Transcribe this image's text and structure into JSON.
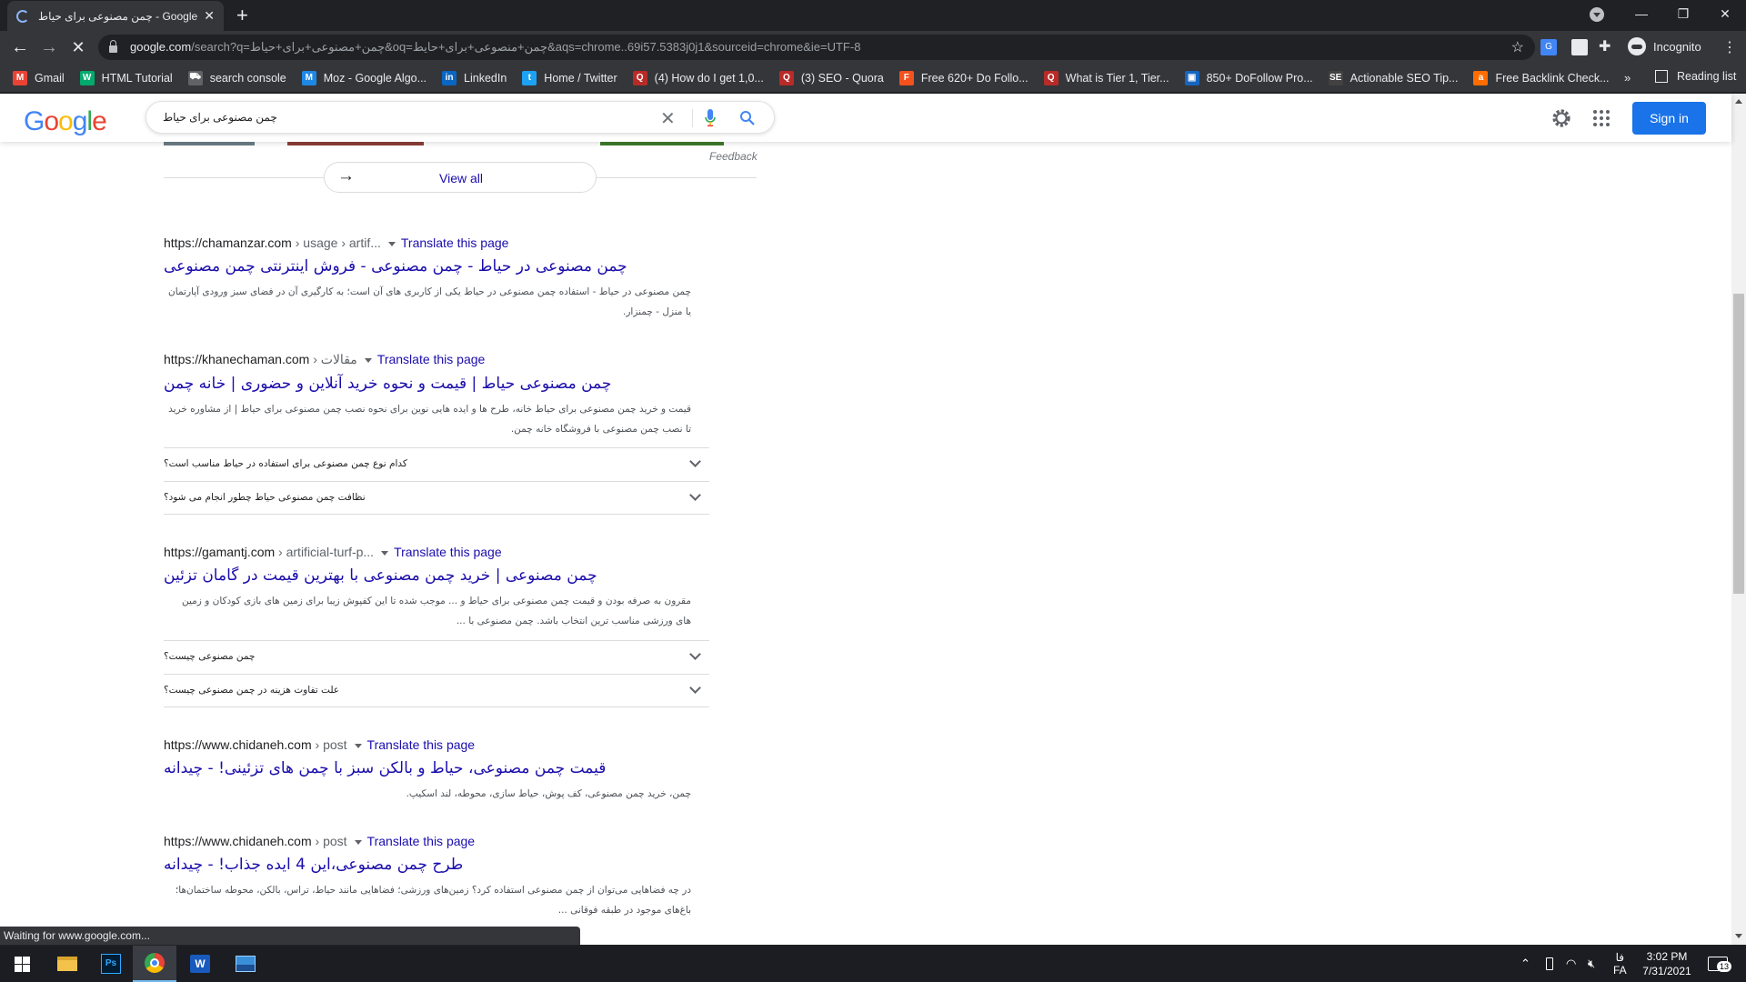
{
  "browser": {
    "tab_title": "چمن مصنوعی برای حیاط - Google Search",
    "new_tab": "+",
    "url_host": "google.com",
    "url_rest": "/search?q=چمن+مصنوعی+برای+حیاط&oq=چمن+منصوعی+برای+حایط&aqs=chrome..69i57.5383j0j1&sourceid=chrome&ie=UTF-8",
    "incognito_label": "Incognito",
    "bookmarks": [
      {
        "label": "Gmail",
        "color": "#ea4335",
        "glyph": "M"
      },
      {
        "label": "HTML Tutorial",
        "color": "#04aa6d",
        "glyph": "W"
      },
      {
        "label": "search console",
        "color": "#5f6368",
        "glyph": "⛟"
      },
      {
        "label": "Moz - Google Algo...",
        "color": "#1e88e5",
        "glyph": "M"
      },
      {
        "label": "LinkedIn",
        "color": "#0a66c2",
        "glyph": "in"
      },
      {
        "label": "Home / Twitter",
        "color": "#1da1f2",
        "glyph": "t"
      },
      {
        "label": "(4) How do I get 1,0...",
        "color": "#b92b27",
        "glyph": "Q"
      },
      {
        "label": "(3) SEO - Quora",
        "color": "#b92b27",
        "glyph": "Q"
      },
      {
        "label": "Free 620+ Do Follo...",
        "color": "#f4511e",
        "glyph": "F"
      },
      {
        "label": "What is Tier 1, Tier...",
        "color": "#b92b27",
        "glyph": "Q"
      },
      {
        "label": "850+ DoFollow Pro...",
        "color": "#1565c0",
        "glyph": "▣"
      },
      {
        "label": "Actionable SEO Tip...",
        "color": "#424242",
        "glyph": "SE"
      },
      {
        "label": "Free Backlink Check...",
        "color": "#ff6d00",
        "glyph": "a"
      }
    ],
    "bookmarks_more": "»",
    "reading_list": "Reading list",
    "status_text": "Waiting for www.google.com..."
  },
  "google": {
    "query": "چمن مصنوعی برای حیاط",
    "sign_in": "Sign in",
    "feedback": "Feedback",
    "view_all": "View all",
    "translate": "Translate this page",
    "results": [
      {
        "host": "https://chamanzar.com",
        "path": " › usage › artif...",
        "title": "چمن مصنوعی در حیاط - چمن مصنوعی - فروش اینترنتی چمن مصنوعی",
        "snippet": "چمن مصنوعی در حیاط - استفاده چمن مصنوعی در حیاط یکی از کاربری های آن است؛ به کارگیری آن در فضای سبز ورودی آپارتمان یا منزل - چمنزار."
      },
      {
        "host": "https://khanechaman.com",
        "path": " › مقالات",
        "title": "چمن مصنوعی حیاط | قیمت و نحوه خرید آنلاین و حضوری | خانه چمن",
        "snippet": "قیمت و خرید چمن مصنوعی برای حیاط خانه، طرح ها و ایده هایی نوین برای نحوه نصب چمن مصنوعی برای حیاط | از مشاوره خرید تا نصب چمن مصنوعی با فروشگاه خانه چمن."
      },
      {
        "host": "https://gamantj.com",
        "path": " › artificial-turf-p...",
        "title": "چمن مصنوعی | خرید چمن مصنوعی با بهترین قیمت در گامان تزئین",
        "snippet": "مقرون به صرفه بودن و قیمت چمن مصنوعی برای حیاط و ... موجب شده تا این کفپوش زیبا برای زمین های بازی کودکان و زمین های ورزشی مناسب ترین انتخاب باشد. چمن مصنوعی با ..."
      },
      {
        "host": "https://www.chidaneh.com",
        "path": " › post",
        "title": "قیمت چمن مصنوعی، حیاط و بالکن سبز با چمن های تزئینی! - چیدانه",
        "snippet": "چمن، خرید چمن مصنوعی، کف پوش، حیاط سازی، محوطه، لند اسکیپ."
      },
      {
        "host": "https://www.chidaneh.com",
        "path": " › post",
        "title": "طرح چمن مصنوعی،این 4 ایده جذاب! - چیدانه",
        "snippet": "در چه فضاهایی می‌توان از چمن مصنوعی استفاده کرد؟ زمین‌های ورزشی؛ فضاهایی مانند حیاط، تراس، بالکن، محوطه ساختمان‌ها؛ باغ‌های موجود در طبقه فوقانی ..."
      }
    ],
    "faqs": {
      "r2": [
        "کدام نوع چمن مصنوعی برای استفاده در حیاط مناسب است؟",
        "نظافت چمن مصنوعی حیاط چطور انجام می شود؟"
      ],
      "r3": [
        "چمن مصنوعی چیست؟",
        "علت تفاوت هزینه در چمن مصنوعی چیست؟"
      ]
    }
  },
  "taskbar": {
    "time": "3:02 PM",
    "date": "7/31/2021",
    "lang_top": "فا",
    "lang_bottom": "FA",
    "notif_count": "13"
  }
}
